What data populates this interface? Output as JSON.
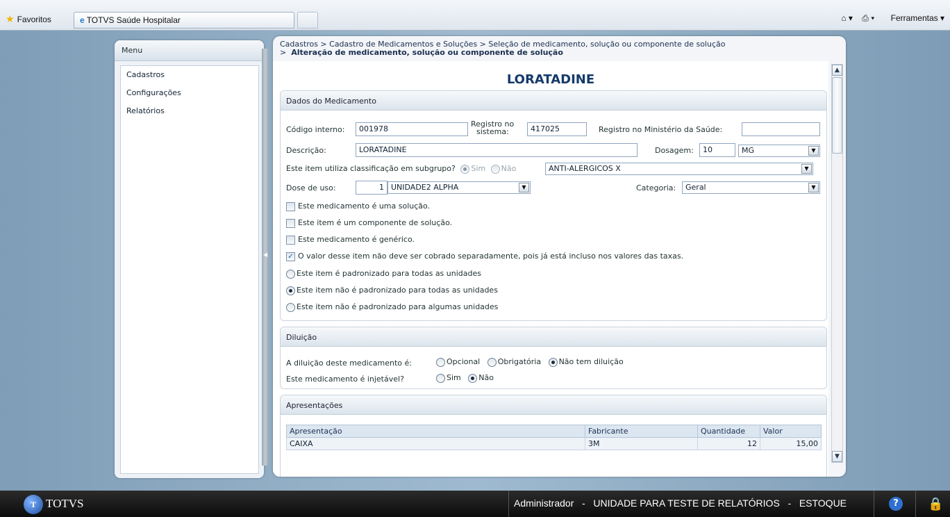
{
  "browser": {
    "favorites": "Favoritos",
    "tab_title": "TOTVS Saúde Hospitalar",
    "tools": "Ferramentas"
  },
  "menu": {
    "header": "Menu",
    "items": [
      "Cadastros",
      "Configurações",
      "Relatórios"
    ]
  },
  "breadcrumb": {
    "line1": "Cadastros  >  Cadastro de Medicamentos e Soluções  >  Seleção de medicamento, solução ou componente de solução",
    "sep": ">",
    "current": "Alteração de medicamento, solução ou componente de solução"
  },
  "page_title": "LORATADINE",
  "dados": {
    "header": "Dados do Medicamento",
    "codigo_label": "Código interno:",
    "codigo_value": "001978",
    "registro_label_1": "Registro no",
    "registro_label_2": "sistema:",
    "registro_value": "417025",
    "ministerio_label": "Registro no Ministério da Saúde:",
    "ministerio_value": "",
    "descricao_label": "Descrição:",
    "descricao_value": "LORATADINE",
    "dosagem_label": "Dosagem:",
    "dosagem_value": "10",
    "dosagem_unit": "MG",
    "subgrupo_label": "Este item utiliza classificação em subgrupo?",
    "sim": "Sim",
    "nao": "Não",
    "subgrupo_value": "ANTI-ALERGICOS X",
    "dose_label": "Dose de uso:",
    "dose_value": "1",
    "dose_unit": "UNIDADE2 ALPHA",
    "categoria_label": "Categoria:",
    "categoria_value": "Geral",
    "check_solucao": "Este medicamento é uma solução.",
    "check_componente": "Este item é um componente de solução.",
    "check_generico": "Este medicamento é genérico.",
    "check_valor": "O valor desse item não deve ser cobrado separadamente, pois já está incluso nos valores das taxas.",
    "radio_padronizado_todas": "Este item é padronizado para todas as unidades",
    "radio_nao_padronizado_todas": "Este item não é padronizado para todas as unidades",
    "radio_nao_padronizado_algumas": "Este item não é padronizado para algumas unidades"
  },
  "diluicao": {
    "header": "Diluição",
    "label": "A diluição deste medicamento é:",
    "opcional": "Opcional",
    "obrigatoria": "Obrigatória",
    "nao_tem": "Não tem diluição",
    "injetavel_label": "Este medicamento é injetável?",
    "sim": "Sim",
    "nao": "Não"
  },
  "apresentacoes": {
    "header": "Apresentações",
    "columns": [
      "Apresentação",
      "Fabricante",
      "Quantidade",
      "Valor"
    ],
    "rows": [
      [
        "CAIXA",
        "3M",
        "12",
        "15,00"
      ]
    ]
  },
  "statusbar": {
    "brand": "TOTVS",
    "user": "Administrador",
    "sep": "-",
    "unit": "UNIDADE PARA TESTE DE RELATÓRIOS",
    "module": "ESTOQUE"
  },
  "colors": {
    "title": "#143a6a",
    "background": "#8eadc4",
    "taskbar": "#0c0c0c"
  },
  "icons": [
    "star-icon",
    "ie-icon",
    "home-icon",
    "printer-icon",
    "scroll-up-icon",
    "scroll-down-icon",
    "collapse-arrow-icon",
    "help-icon",
    "lock-icon"
  ]
}
